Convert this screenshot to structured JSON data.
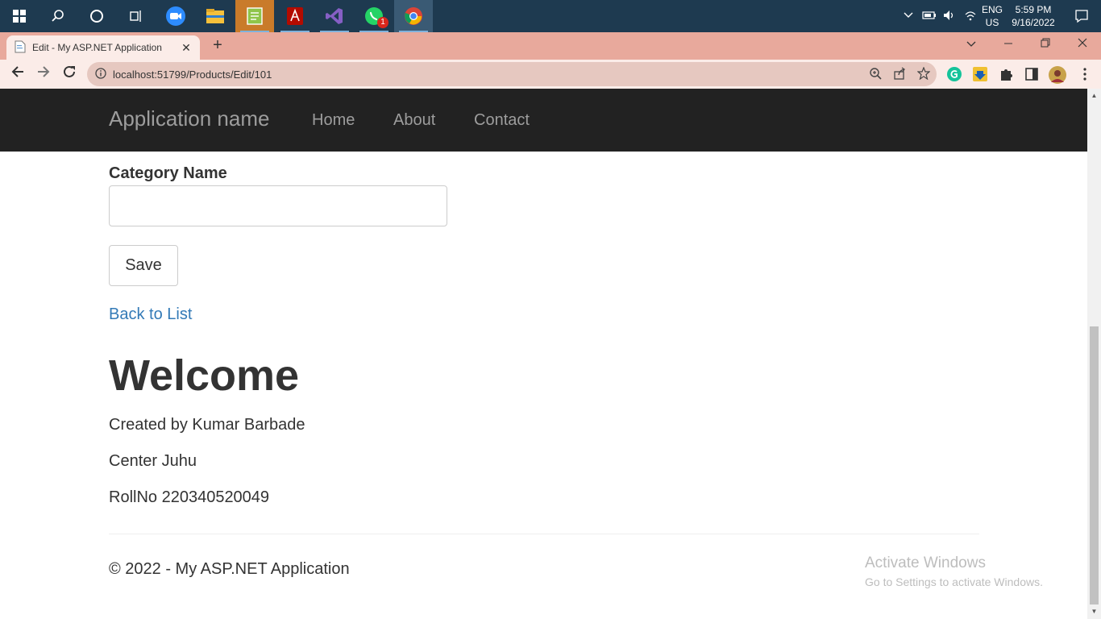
{
  "taskbar": {
    "lang_top": "ENG",
    "lang_bottom": "US",
    "time": "5:59 PM",
    "date": "9/16/2022",
    "whatsapp_badge": "1",
    "icons": [
      "windows-start-icon",
      "search-icon",
      "cortana-icon",
      "task-view-icon",
      "zoom-icon",
      "file-explorer-icon",
      "notepad-icon",
      "acrobat-icon",
      "visual-studio-icon",
      "whatsapp-icon",
      "chrome-icon"
    ]
  },
  "browser": {
    "tab_title": "Edit - My ASP.NET Application",
    "tab_close": "✕",
    "new_tab": "+",
    "url": "localhost:51799/Products/Edit/101"
  },
  "navbar": {
    "brand": "Application name",
    "links": [
      "Home",
      "About",
      "Contact"
    ]
  },
  "form": {
    "category_label": "Category Name",
    "category_value": "",
    "save_label": "Save",
    "back_link": "Back to List"
  },
  "welcome": {
    "heading": "Welcome",
    "lines": [
      "Created by Kumar Barbade",
      "Center Juhu",
      "RollNo 220340520049"
    ]
  },
  "footer": {
    "text": "© 2022 - My ASP.NET Application"
  },
  "watermark": {
    "title": "Activate Windows",
    "subtitle": "Go to Settings to activate Windows."
  }
}
